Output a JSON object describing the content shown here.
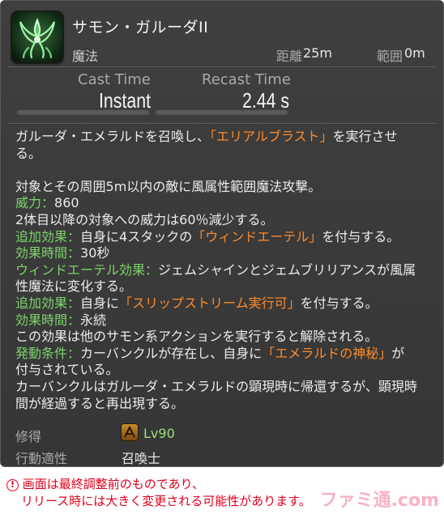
{
  "header": {
    "icon": "garuda-summon-icon",
    "name": "サモン・ガルーダII",
    "type": "魔法",
    "range_label": "距離",
    "range_value": "25m",
    "radius_label": "範囲",
    "radius_value": "0m"
  },
  "times": {
    "cast_label": "Cast Time",
    "cast_value": "Instant",
    "recast_label": "Recast Time",
    "recast_value": "2.44 s"
  },
  "description": {
    "l1_a": "ガルーダ・エメラルドを召喚し、",
    "l1_b": "「エリアルブラスト」",
    "l1_c": "を実行させ",
    "l2": "る。",
    "l3": "対象とその周囲5m以内の敵に風属性範囲魔法攻撃。",
    "l4_label": "威力",
    "l4_sep": "：",
    "l4_value": "860",
    "l5": "2体目以降の対象への威力は60％減少する。",
    "l6_label": "追加効果",
    "l6_sep": "：",
    "l6_a": "自身に4スタックの",
    "l6_b": "「ウィンドエーテル」",
    "l6_c": "を付与する。",
    "l7_label": "効果時間",
    "l7_sep": "：",
    "l7_value": "30秒",
    "l8_label": "ウィンドエーテル効果",
    "l8_sep": "：",
    "l8_value": "ジェムシャインとジェムブリリアンスが風属",
    "l9": "性魔法に変化する。",
    "l10_label": "追加効果",
    "l10_sep": "：",
    "l10_a": "自身に",
    "l10_b": "「スリップストリーム実行可」",
    "l10_c": "を付与する。",
    "l11_label": "効果時間",
    "l11_sep": "：",
    "l11_value": "永続",
    "l12": "この効果は他のサモン系アクションを実行すると解除される。",
    "l13_label": "発動条件",
    "l13_sep": "：",
    "l13_a": "カーバンクルが存在し、自身に",
    "l13_b": "「エメラルドの神秘」",
    "l13_c": "が",
    "l14": "付与されている。",
    "l15": "カーバンクルはガルーダ・エメラルドの顕現時に帰還するが、顕現時",
    "l16": "間が経過すると再出現する。"
  },
  "footer": {
    "acquire_label": "修得",
    "job_icon": "summoner-job-icon",
    "acquire_value": "Lv90",
    "class_label": "行動適性",
    "class_value": "召喚士"
  },
  "notice": {
    "icon": "warning-icon",
    "line1": "画面は最終調整前のものであり、",
    "line2": "リリース時には大きく変更される可能性があります。"
  },
  "watermark": "ファミ通.com",
  "colors": {
    "panel_bg": "#3a3a3a",
    "highlight_green": "#7ed36b",
    "highlight_orange": "#ff8a2a",
    "notice_red": "#e0001a"
  }
}
